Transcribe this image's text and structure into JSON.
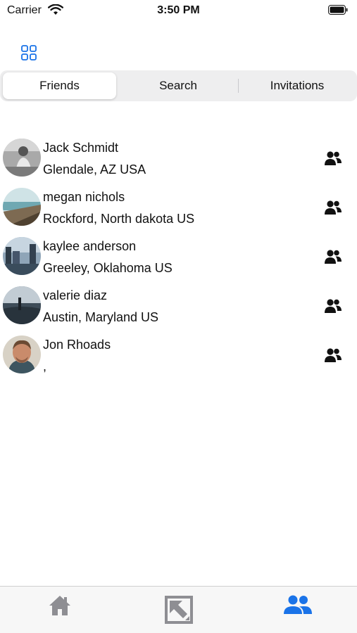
{
  "status_bar": {
    "carrier": "Carrier",
    "time": "3:50 PM"
  },
  "segments": [
    {
      "label": "Friends",
      "active": true
    },
    {
      "label": "Search",
      "active": false
    },
    {
      "label": "Invitations",
      "active": false
    }
  ],
  "friends": [
    {
      "name": "Jack Schmidt",
      "location": "Glendale, AZ USA"
    },
    {
      "name": "megan nichols",
      "location": "Rockford, North dakota US"
    },
    {
      "name": "kaylee anderson",
      "location": "Greeley, Oklahoma US"
    },
    {
      "name": "valerie diaz",
      "location": "Austin, Maryland US"
    },
    {
      "name": "Jon Rhoads",
      "location": ","
    }
  ],
  "tabbar": {
    "icons": [
      "home-icon",
      "photo-icon",
      "friends-icon"
    ],
    "active_tab": "friends"
  },
  "colors": {
    "accent": "#1a73e8",
    "icon_gray": "#8e8e93",
    "segment_bg": "#eeeeef"
  }
}
